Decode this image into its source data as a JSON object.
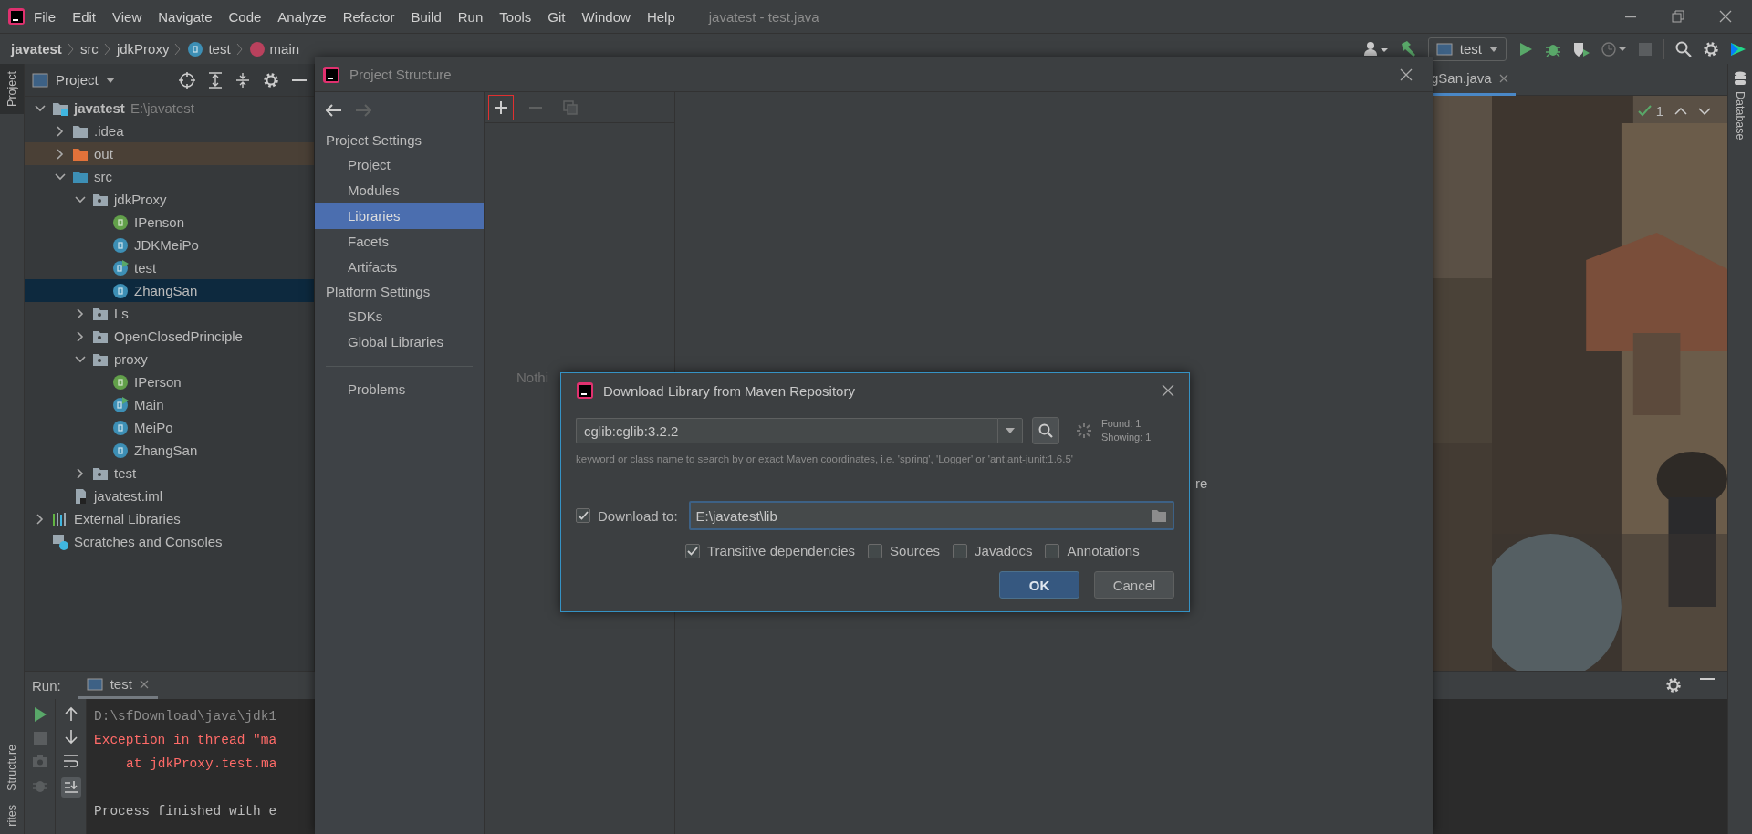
{
  "window": {
    "title": "javatest - test.java"
  },
  "menu": [
    "File",
    "Edit",
    "View",
    "Navigate",
    "Code",
    "Analyze",
    "Refactor",
    "Build",
    "Run",
    "Tools",
    "Git",
    "Window",
    "Help"
  ],
  "breadcrumbs": [
    {
      "label": "javatest",
      "kind": "project"
    },
    {
      "label": "src",
      "kind": "folder"
    },
    {
      "label": "jdkProxy",
      "kind": "folder"
    },
    {
      "label": "test",
      "kind": "class"
    },
    {
      "label": "main",
      "kind": "method"
    }
  ],
  "toolbar": {
    "run_config": "test"
  },
  "left_strip": {
    "top": [
      {
        "label": "Project",
        "selected": true
      }
    ],
    "bottom": [
      {
        "label": "Structure",
        "selected": false
      },
      {
        "label": "rites",
        "selected": false
      }
    ]
  },
  "project_panel": {
    "title": "Project",
    "tree": [
      {
        "label": "javatest",
        "path": "E:\\javatest",
        "kind": "project",
        "expanded": true,
        "selected": false,
        "children": [
          {
            "label": ".idea",
            "kind": "folder",
            "expanded": false,
            "selected": false
          },
          {
            "label": "out",
            "kind": "excluded",
            "expanded": false,
            "selected": false
          },
          {
            "label": "src",
            "kind": "source",
            "expanded": true,
            "selected": false,
            "children": [
              {
                "label": "jdkProxy",
                "kind": "package",
                "expanded": true,
                "selected": false,
                "children": [
                  {
                    "label": "IPenson",
                    "kind": "interface",
                    "selected": false
                  },
                  {
                    "label": "JDKMeiPo",
                    "kind": "class",
                    "selected": false
                  },
                  {
                    "label": "test",
                    "kind": "main-class",
                    "selected": false
                  },
                  {
                    "label": "ZhangSan",
                    "kind": "class",
                    "selected": true
                  }
                ]
              },
              {
                "label": "Ls",
                "kind": "package",
                "expanded": false,
                "selected": false
              },
              {
                "label": "OpenClosedPrinciple",
                "kind": "package",
                "expanded": false,
                "selected": false
              },
              {
                "label": "proxy",
                "kind": "package",
                "expanded": true,
                "selected": false,
                "children": [
                  {
                    "label": "IPerson",
                    "kind": "interface",
                    "selected": false
                  },
                  {
                    "label": "Main",
                    "kind": "main-class",
                    "selected": false
                  },
                  {
                    "label": "MeiPo",
                    "kind": "class",
                    "selected": false
                  },
                  {
                    "label": "ZhangSan",
                    "kind": "class",
                    "selected": false
                  }
                ]
              },
              {
                "label": "test",
                "kind": "package",
                "expanded": false,
                "selected": false
              }
            ]
          },
          {
            "label": "javatest.iml",
            "kind": "module-file",
            "selected": false
          }
        ]
      },
      {
        "label": "External Libraries",
        "kind": "libraries",
        "expanded": false,
        "selected": false
      },
      {
        "label": "Scratches and Consoles",
        "kind": "scratches",
        "selected": false
      }
    ]
  },
  "editor": {
    "tabs": [
      {
        "label": "gSan.java",
        "selected": true
      }
    ],
    "inspections": "1"
  },
  "right_strip": [
    {
      "label": "Database",
      "selected": false
    }
  ],
  "run_panel": {
    "label": "Run:",
    "tabs": [
      {
        "label": "test",
        "selected": true
      }
    ],
    "lines": [
      {
        "kind": "command",
        "text": "D:\\sfDownload\\java\\jdk1"
      },
      {
        "kind": "error",
        "text": "Exception in thread \"ma"
      },
      {
        "kind": "trace",
        "text": "at jdkProxy.test.ma"
      },
      {
        "kind": "blank"
      },
      {
        "kind": "normal",
        "text": "Process finished with e"
      }
    ]
  },
  "project_structure": {
    "title": "Project Structure",
    "sections": [
      {
        "title": "Project Settings",
        "items": [
          {
            "label": "Project",
            "selected": false
          },
          {
            "label": "Modules",
            "selected": false
          },
          {
            "label": "Libraries",
            "selected": true
          },
          {
            "label": "Facets",
            "selected": false
          },
          {
            "label": "Artifacts",
            "selected": false
          }
        ]
      },
      {
        "title": "Platform Settings",
        "items": [
          {
            "label": "SDKs",
            "selected": false
          },
          {
            "label": "Global Libraries",
            "selected": false
          }
        ]
      },
      {
        "items": [
          {
            "label": "Problems",
            "selected": false
          }
        ]
      }
    ],
    "empty_text": "Nothi",
    "detail_text": "re"
  },
  "maven_dialog": {
    "title": "Download Library from Maven Repository",
    "query": "cglib:cglib:3.2.2",
    "found": "Found: 1",
    "showing": "Showing: 1",
    "hint": "keyword or class name to search by or exact Maven coordinates, i.e. 'spring', 'Logger' or 'ant:ant-junit:1.6.5'",
    "download_to": {
      "label": "Download to:",
      "checked": true,
      "value": "E:\\javatest\\lib"
    },
    "options": [
      {
        "label": "Transitive dependencies",
        "checked": true
      },
      {
        "label": "Sources",
        "checked": false
      },
      {
        "label": "Javadocs",
        "checked": false
      },
      {
        "label": "Annotations",
        "checked": false
      }
    ],
    "buttons": [
      {
        "label": "OK",
        "kind": "default"
      },
      {
        "label": "Cancel",
        "kind": "normal"
      }
    ]
  }
}
